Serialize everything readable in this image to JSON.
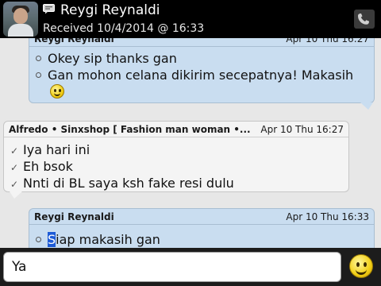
{
  "header": {
    "contact_name": "Reygi Reynaldi",
    "received": "Received 10/4/2014 @ 16:33"
  },
  "messages": [
    {
      "sender": "Reygi Reynaldi",
      "timestamp": "Apr 10 Thu 16:27",
      "lines": [
        "Okey sip thanks gan",
        "Gan mohon celana dikirim secepatnya! Makasih"
      ]
    },
    {
      "sender": "Alfredo • Sinxshop [ Fashion man woman •...",
      "timestamp": "Apr 10 Thu 16:27",
      "lines": [
        "Iya hari ini",
        "Eh bsok",
        "Nnti di BL saya ksh fake resi dulu"
      ]
    },
    {
      "sender": "Reygi Reynaldi",
      "timestamp": "Apr 10 Thu 16:33",
      "first_char": "S",
      "rest": "iap makasih gan"
    }
  ],
  "compose": {
    "value": "Ya"
  },
  "colors": {
    "header_bg": "#000000",
    "outgoing_bubble": "#c9ddf0",
    "incoming_bubble": "#f4f4f4",
    "compose_bg": "#1c1c1c"
  },
  "icons": [
    "contact-avatar",
    "bbm-chat-icon",
    "phone-icon",
    "smiley-emoticon",
    "delivered-check-icon",
    "emoticon-button"
  ]
}
